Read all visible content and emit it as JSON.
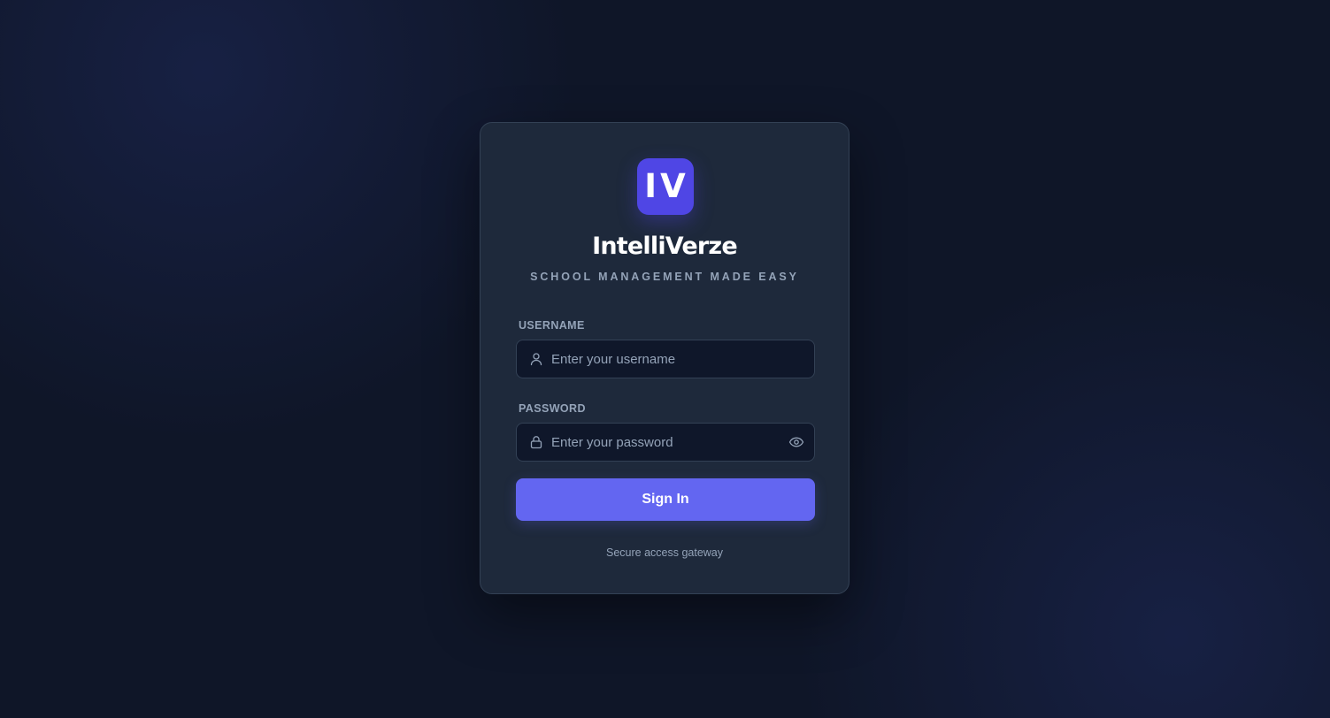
{
  "brand": {
    "logo_text": "IV",
    "name": "IntelliVerze",
    "tagline": "SCHOOL MANAGEMENT MADE EASY"
  },
  "form": {
    "username": {
      "label": "USERNAME",
      "value": "",
      "placeholder": "Enter your username",
      "icon": "user-icon"
    },
    "password": {
      "label": "PASSWORD",
      "value": "",
      "placeholder": "Enter your password",
      "icon": "lock-icon",
      "toggle_icon": "eye-icon"
    },
    "submit_label": "Sign In"
  },
  "footer": {
    "note": "Secure access gateway"
  },
  "colors": {
    "background": "#0f1628",
    "card": "#1e293b",
    "logo": "#4f46e5",
    "accent": "#6366f1",
    "muted_text": "#94a3b8"
  }
}
